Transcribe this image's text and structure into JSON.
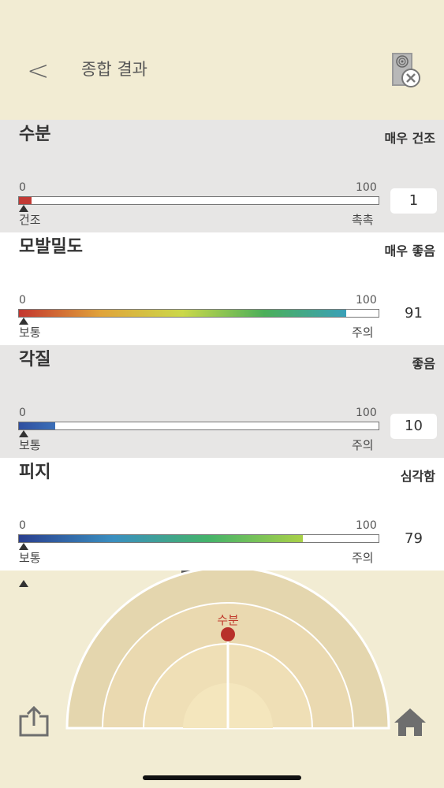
{
  "header": {
    "back_label": "<",
    "title": "종합 결과"
  },
  "sections": [
    {
      "title": "수분",
      "status": "매우 건조",
      "min": "0",
      "max": "100",
      "left_label": "건조",
      "right_label": "촉촉",
      "value": "1",
      "level": 1,
      "gradient": [
        "#c23a35",
        "#c23a35"
      ]
    },
    {
      "title": "모발밀도",
      "status": "매우 좋음",
      "min": "0",
      "max": "100",
      "left_label": "보통",
      "right_label": "주의",
      "value": "91",
      "level": 91,
      "gradient": [
        "#c3362f",
        "#e0a33a",
        "#cbd84a",
        "#4caf5a",
        "#3aa0b8"
      ]
    },
    {
      "title": "각질",
      "status": "좋음",
      "min": "0",
      "max": "100",
      "left_label": "보통",
      "right_label": "주의",
      "value": "10",
      "level": 10,
      "gradient": [
        "#2f4fa0",
        "#3b6fb8"
      ]
    },
    {
      "title": "피지",
      "status": "심각함",
      "min": "0",
      "max": "100",
      "left_label": "보통",
      "right_label": "주의",
      "value": "79",
      "level": 79,
      "gradient": [
        "#2a3f8f",
        "#3a8fc0",
        "#44b36a",
        "#a9d048"
      ]
    }
  ],
  "gauge": {
    "label": "수분"
  },
  "colors": {
    "background": "#f2ecd3",
    "marker": "#b8302a"
  }
}
